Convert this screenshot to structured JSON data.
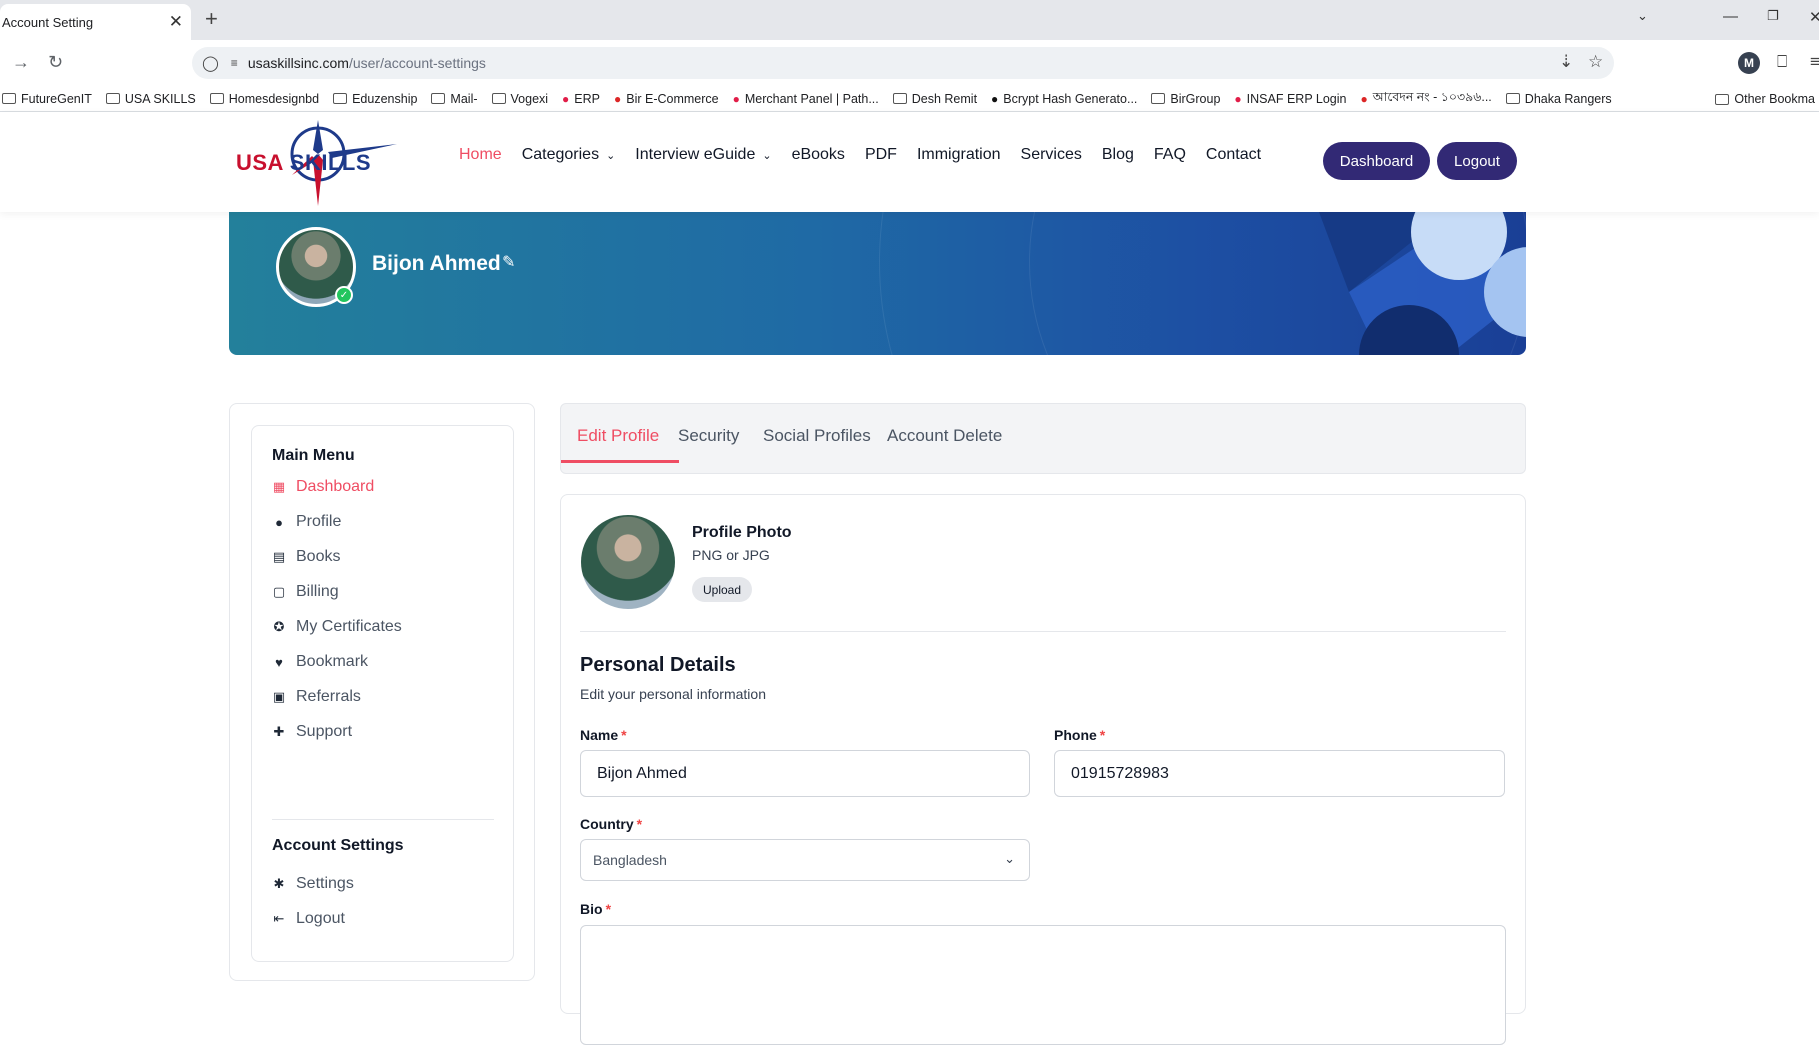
{
  "browser": {
    "tab_title": "Account Setting",
    "tab_close": "✕",
    "new_tab": "+",
    "url_domain": "usaskillsinc.com",
    "url_path": "/user/account-settings",
    "profile_initial": "M",
    "bookmarks": [
      {
        "label": "FutureGenIT",
        "type": "folder"
      },
      {
        "label": "USA SKILLS",
        "type": "folder"
      },
      {
        "label": "Homesdesignbd",
        "type": "folder"
      },
      {
        "label": "Eduzenship",
        "type": "folder"
      },
      {
        "label": "Mail-",
        "type": "folder"
      },
      {
        "label": "Vogexi",
        "type": "folder"
      },
      {
        "label": "ERP",
        "type": "site"
      },
      {
        "label": "Bir E-Commerce",
        "type": "site"
      },
      {
        "label": "Merchant Panel | Path...",
        "type": "site"
      },
      {
        "label": "Desh Remit",
        "type": "folder"
      },
      {
        "label": "Bcrypt Hash Generato...",
        "type": "site"
      },
      {
        "label": "BirGroup",
        "type": "folder"
      },
      {
        "label": "INSAF ERP Login",
        "type": "site"
      },
      {
        "label": "আবেদন নং - ১০৩৯৬...",
        "type": "site"
      },
      {
        "label": "Dhaka Rangers",
        "type": "folder"
      }
    ],
    "other_bookmarks": "Other Bookma"
  },
  "header": {
    "logo_usa": "USA",
    "logo_skills": "SKILLS",
    "nav": [
      {
        "label": "Home",
        "active": true,
        "caret": false
      },
      {
        "label": "Categories",
        "active": false,
        "caret": true
      },
      {
        "label": "Interview eGuide",
        "active": false,
        "caret": true
      },
      {
        "label": "eBooks",
        "active": false,
        "caret": false
      },
      {
        "label": "PDF",
        "active": false,
        "caret": false
      },
      {
        "label": "Immigration",
        "active": false,
        "caret": false
      },
      {
        "label": "Services",
        "active": false,
        "caret": false
      },
      {
        "label": "Blog",
        "active": false,
        "caret": false
      },
      {
        "label": "FAQ",
        "active": false,
        "caret": false
      },
      {
        "label": "Contact",
        "active": false,
        "caret": false
      }
    ],
    "dashboard_button": "Dashboard",
    "logout_button": "Logout"
  },
  "banner": {
    "user_name": "Bijon Ahmed"
  },
  "sidebar": {
    "main_heading": "Main Menu",
    "main_items": [
      {
        "label": "Dashboard",
        "icon": "dashboard-icon",
        "active": true
      },
      {
        "label": "Profile",
        "icon": "user-icon",
        "active": false
      },
      {
        "label": "Books",
        "icon": "book-icon",
        "active": false
      },
      {
        "label": "Billing",
        "icon": "receipt-icon",
        "active": false
      },
      {
        "label": "My Certificates",
        "icon": "certificate-icon",
        "active": false
      },
      {
        "label": "Bookmark",
        "icon": "heart-icon",
        "active": false
      },
      {
        "label": "Referrals",
        "icon": "referral-icon",
        "active": false
      },
      {
        "label": "Support",
        "icon": "support-icon",
        "active": false
      }
    ],
    "settings_heading": "Account Settings",
    "settings_items": [
      {
        "label": "Settings",
        "icon": "gear-icon"
      },
      {
        "label": "Logout",
        "icon": "logout-icon"
      }
    ]
  },
  "tabs": [
    {
      "label": "Edit Profile",
      "active": true
    },
    {
      "label": "Security",
      "active": false
    },
    {
      "label": "Social Profiles",
      "active": false
    },
    {
      "label": "Account Delete",
      "active": false
    }
  ],
  "form": {
    "photo_title": "Profile Photo",
    "photo_hint": "PNG or JPG",
    "upload_label": "Upload",
    "section_title": "Personal Details",
    "section_subtitle": "Edit your personal information",
    "name_label": "Name",
    "name_value": "Bijon Ahmed",
    "phone_label": "Phone",
    "phone_value": "01915728983",
    "country_label": "Country",
    "country_value": "Bangladesh",
    "bio_label": "Bio",
    "required_mark": "*"
  },
  "colors": {
    "accent": "#ef4d63",
    "primary_button": "#322975",
    "banner_start": "#23809b",
    "banner_end": "#1a3f96"
  }
}
